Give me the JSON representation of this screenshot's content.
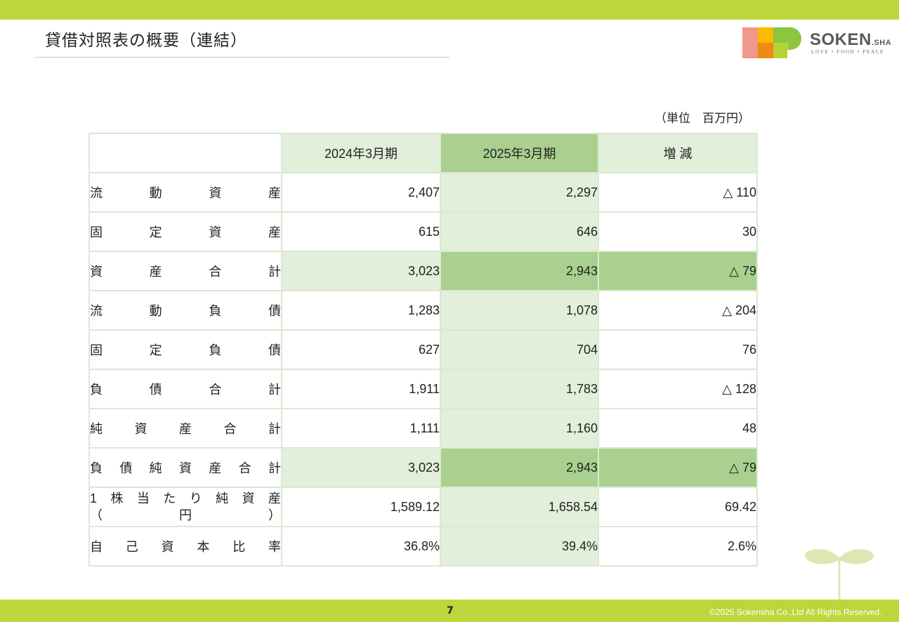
{
  "header": {
    "title": "貸借対照表の概要（連結）"
  },
  "logo": {
    "name": "SOKEN",
    "suffix": ".SHA",
    "tagline": "LOVE • FOOD • PEACE"
  },
  "unit_note": "（単位　百万円）",
  "table": {
    "columns": [
      "",
      "2024年3月期",
      "2025年3月期",
      "増 減"
    ],
    "rows": [
      {
        "chars": [
          "流",
          "動",
          "資",
          "産"
        ],
        "v2024": "2,407",
        "v2025": "2,297",
        "change": "△ 110",
        "highlight": false
      },
      {
        "chars": [
          "固",
          "定",
          "資",
          "産"
        ],
        "v2024": "615",
        "v2025": "646",
        "change": "30",
        "highlight": false
      },
      {
        "chars": [
          "資",
          "産",
          "合",
          "計"
        ],
        "v2024": "3,023",
        "v2025": "2,943",
        "change": "△ 79",
        "highlight": true
      },
      {
        "chars": [
          "流",
          "動",
          "負",
          "債"
        ],
        "v2024": "1,283",
        "v2025": "1,078",
        "change": "△ 204",
        "highlight": false
      },
      {
        "chars": [
          "固",
          "定",
          "負",
          "債"
        ],
        "v2024": "627",
        "v2025": "704",
        "change": "76",
        "highlight": false
      },
      {
        "chars": [
          "負",
          "債",
          "合",
          "計"
        ],
        "v2024": "1,911",
        "v2025": "1,783",
        "change": "△ 128",
        "highlight": false
      },
      {
        "chars": [
          "純",
          "資",
          "産",
          "合",
          "計"
        ],
        "v2024": "1,111",
        "v2025": "1,160",
        "change": "48",
        "highlight": false
      },
      {
        "chars": [
          "負",
          "債",
          "純",
          "資",
          "産",
          "合",
          "計"
        ],
        "v2024": "3,023",
        "v2025": "2,943",
        "change": "△ 79",
        "highlight": true
      },
      {
        "chars": [
          "1",
          "株",
          "当",
          "た",
          "り",
          "純",
          "資",
          "産"
        ],
        "chars2": [
          "（",
          "円",
          "）"
        ],
        "v2024": "1,589.12",
        "v2025": "1,658.54",
        "change": "69.42",
        "highlight": false
      },
      {
        "chars": [
          "自",
          "己",
          "資",
          "本",
          "比",
          "率"
        ],
        "v2024": "36.8%",
        "v2025": "39.4%",
        "change": "2.6%",
        "highlight": false
      }
    ]
  },
  "footer": {
    "page_number": "7",
    "copyright": "©2025 Sokensha Co.,Ltd All Rights Reserved."
  },
  "colors": {
    "bar": "#bcd63c",
    "header_light": "#e2efda",
    "header_dark": "#a9d08e"
  }
}
